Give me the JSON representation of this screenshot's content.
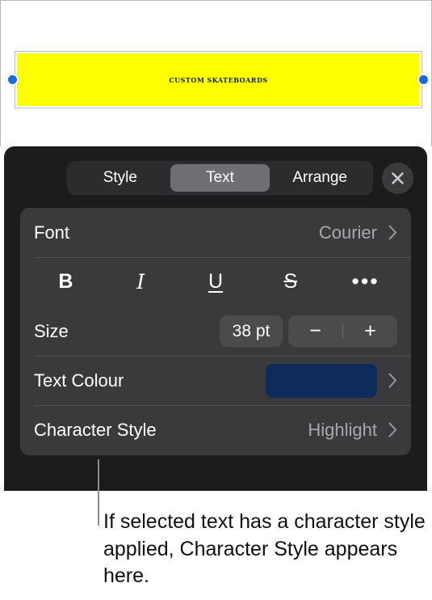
{
  "canvas": {
    "headline_text": "CUSTOM SKATEBOARDS",
    "highlight_color": "#ffff00",
    "text_color": "#101c3e",
    "selection_border_color": "#aec0e4",
    "handle_color": "#1a6ae0"
  },
  "panel": {
    "tabs": [
      {
        "label": "Style",
        "selected": false
      },
      {
        "label": "Text",
        "selected": true
      },
      {
        "label": "Arrange",
        "selected": false
      }
    ],
    "close_label": "",
    "rows": {
      "font": {
        "label": "Font",
        "value": "Courier"
      },
      "style_buttons": [
        {
          "name": "bold",
          "label": "B"
        },
        {
          "name": "italic",
          "label": "I"
        },
        {
          "name": "underline",
          "label": "U"
        },
        {
          "name": "strikethrough",
          "label": "S"
        },
        {
          "name": "more",
          "label": "•••"
        }
      ],
      "size": {
        "label": "Size",
        "value": "38 pt",
        "decrement": "−",
        "increment": "+"
      },
      "text_colour": {
        "label": "Text Colour",
        "swatch_color": "#0e2c5b"
      },
      "character_style": {
        "label": "Character Style",
        "value": "Highlight"
      }
    }
  },
  "callout": {
    "text": "If selected text has a character style applied, Character Style appears here."
  }
}
